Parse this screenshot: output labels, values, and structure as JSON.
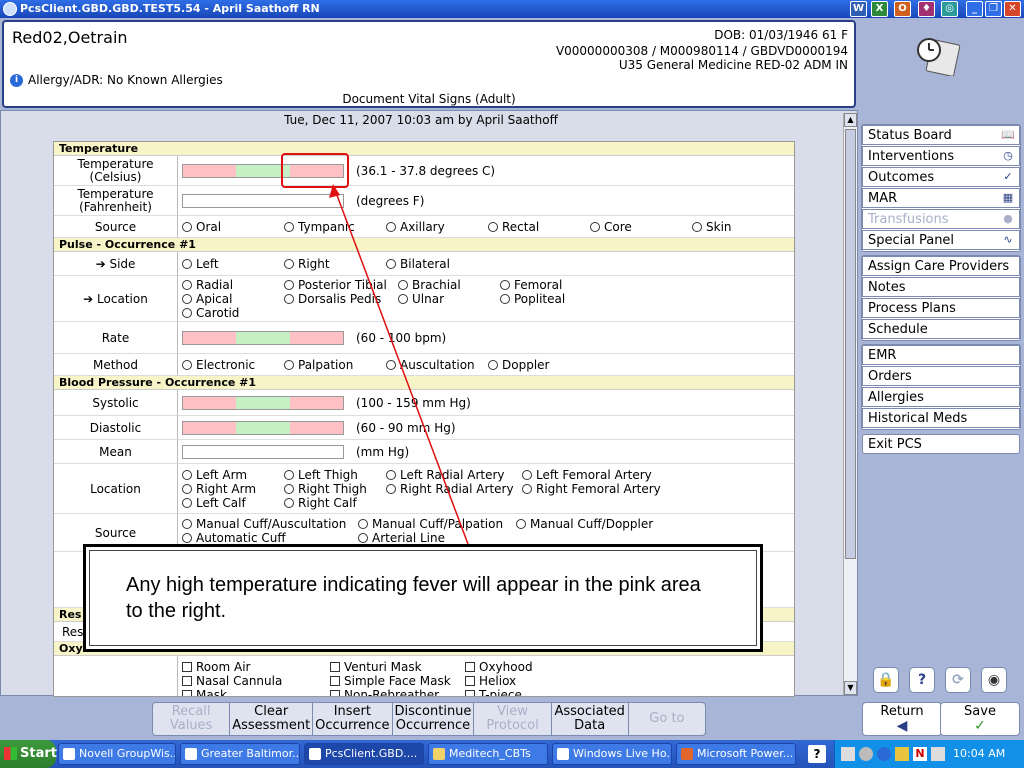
{
  "window": {
    "title": "PcsClient.GBD.GBD.TEST5.54 - April Saathoff RN"
  },
  "patient": {
    "name": "Red02,Oetrain",
    "dob": "DOB: 01/03/1946 61 F",
    "ids": "V00000000308 / M000980114 / GBDVD0000194",
    "location": "U35 General Medicine  RED-02  ADM IN",
    "allergy": "Allergy/ADR: No Known Allergies"
  },
  "document_title": "Document Vital Signs (Adult)",
  "date_line": "Tue,  Dec 11, 2007 10:03 am  by  April Saathoff",
  "sections": {
    "temperature": "Temperature",
    "pulse": "Pulse - Occurrence #1",
    "bp": "Blood Pressure - Occurrence #1",
    "resp": "Res",
    "resp_row": "Res",
    "oxygen": "Oxy"
  },
  "fields": {
    "temp_c": {
      "label": "Temperature (Celsius)",
      "hint": "(36.1 - 37.8 degrees C)"
    },
    "temp_f": {
      "label": "Temperature (Fahrenheit)",
      "hint": "(degrees F)"
    },
    "temp_source": {
      "label": "Source",
      "options": [
        "Oral",
        "Tympanic",
        "Axillary",
        "Rectal",
        "Core",
        "Skin"
      ]
    },
    "pulse_side": {
      "label": "Side",
      "options": [
        "Left",
        "Right",
        "Bilateral"
      ]
    },
    "pulse_location": {
      "label": "Location",
      "options": [
        "Radial",
        "Posterior Tibial",
        "Brachial",
        "Femoral",
        "Apical",
        "Dorsalis Pedis",
        "Ulnar",
        "Popliteal",
        "Carotid"
      ]
    },
    "rate": {
      "label": "Rate",
      "hint": "(60 - 100 bpm)"
    },
    "method": {
      "label": "Method",
      "options": [
        "Electronic",
        "Palpation",
        "Auscultation",
        "Doppler"
      ]
    },
    "systolic": {
      "label": "Systolic",
      "hint": "(100 - 159 mm Hg)"
    },
    "diastolic": {
      "label": "Diastolic",
      "hint": "(60 - 90 mm Hg)"
    },
    "mean": {
      "label": "Mean",
      "hint": "(mm Hg)"
    },
    "bp_location": {
      "label": "Location",
      "options": [
        "Left Arm",
        "Left Thigh",
        "Left Radial Artery",
        "Left Femoral Artery",
        "Right Arm",
        "Right Thigh",
        "Right Radial Artery",
        "Right Femoral Artery",
        "Left Calf",
        "Right Calf"
      ]
    },
    "bp_source": {
      "label": "Source",
      "options": [
        "Manual Cuff/Auscultation",
        "Manual Cuff/Palpation",
        "Manual Cuff/Doppler",
        "Automatic Cuff",
        "Arterial Line"
      ]
    },
    "oxygen_options": [
      "Room Air",
      "Venturi Mask",
      "Oxyhood",
      "Nasal Cannula",
      "Simple Face Mask",
      "Heliox",
      "Mask",
      "Non-Rebreather",
      "T-piece"
    ]
  },
  "callout": "Any high temperature indicating fever will appear in the pink area to the right.",
  "sidebar": {
    "group1": [
      "Status Board",
      "Interventions",
      "Outcomes",
      "MAR",
      "Transfusions",
      "Special Panel"
    ],
    "group2": [
      "Assign Care Providers",
      "Notes",
      "Process Plans",
      "Schedule"
    ],
    "group3": [
      "EMR",
      "Orders",
      "Allergies",
      "Historical Meds"
    ],
    "group4": [
      "Exit PCS"
    ]
  },
  "bottom_buttons": [
    "Recall Values",
    "Clear Assessment",
    "Insert Occurrence",
    "Discontinue Occurrence",
    "View Protocol",
    "Associated Data",
    "Go to"
  ],
  "return_label": "Return",
  "save_label": "Save",
  "taskbar": {
    "start": "Start",
    "tasks": [
      "Novell GroupWis...",
      "Greater Baltimor...",
      "PcsClient.GBD....",
      "Meditech_CBTs",
      "Windows Live Ho...",
      "Microsoft Power..."
    ],
    "clock": "10:04 AM"
  }
}
